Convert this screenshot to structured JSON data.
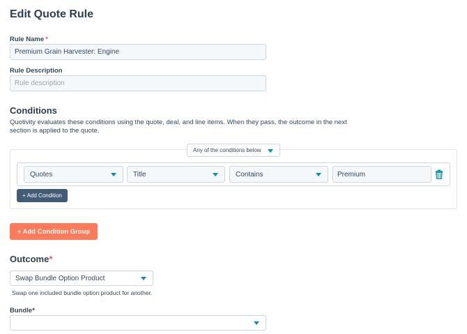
{
  "page": {
    "title": "Edit Quote Rule"
  },
  "rule_name": {
    "label": "Rule Name",
    "required_mark": "*",
    "value": "Premium Grain Harvester: Engine"
  },
  "rule_description": {
    "label": "Rule Description",
    "placeholder": "Rule description"
  },
  "conditions": {
    "title": "Conditions",
    "description_line1": "Quotivity evaluates these conditions using the quote, deal, and line items. When they pass, the outcome in the next",
    "description_line2": "section is applied to the quote.",
    "match_mode": "Any of the conditions below",
    "row": {
      "object": "Quotes",
      "field": "Title",
      "operator": "Contains",
      "value": "Premium"
    },
    "add_condition_label": "+ Add Condition",
    "add_group_label": "+ Add Condition Group"
  },
  "outcome": {
    "title": "Outcome",
    "required_mark": "*",
    "selected": "Swap Bundle Option Product",
    "help": "Swap one included bundle option product for another."
  },
  "bundle": {
    "label": "Bundle*",
    "selected": ""
  },
  "colors": {
    "accent": "#0091ae",
    "primary_button": "#ff7a59",
    "secondary_button": "#425b76",
    "required": "#f2545b"
  },
  "icons": {
    "dropdown": "caret-down-icon",
    "delete": "trash-icon"
  }
}
